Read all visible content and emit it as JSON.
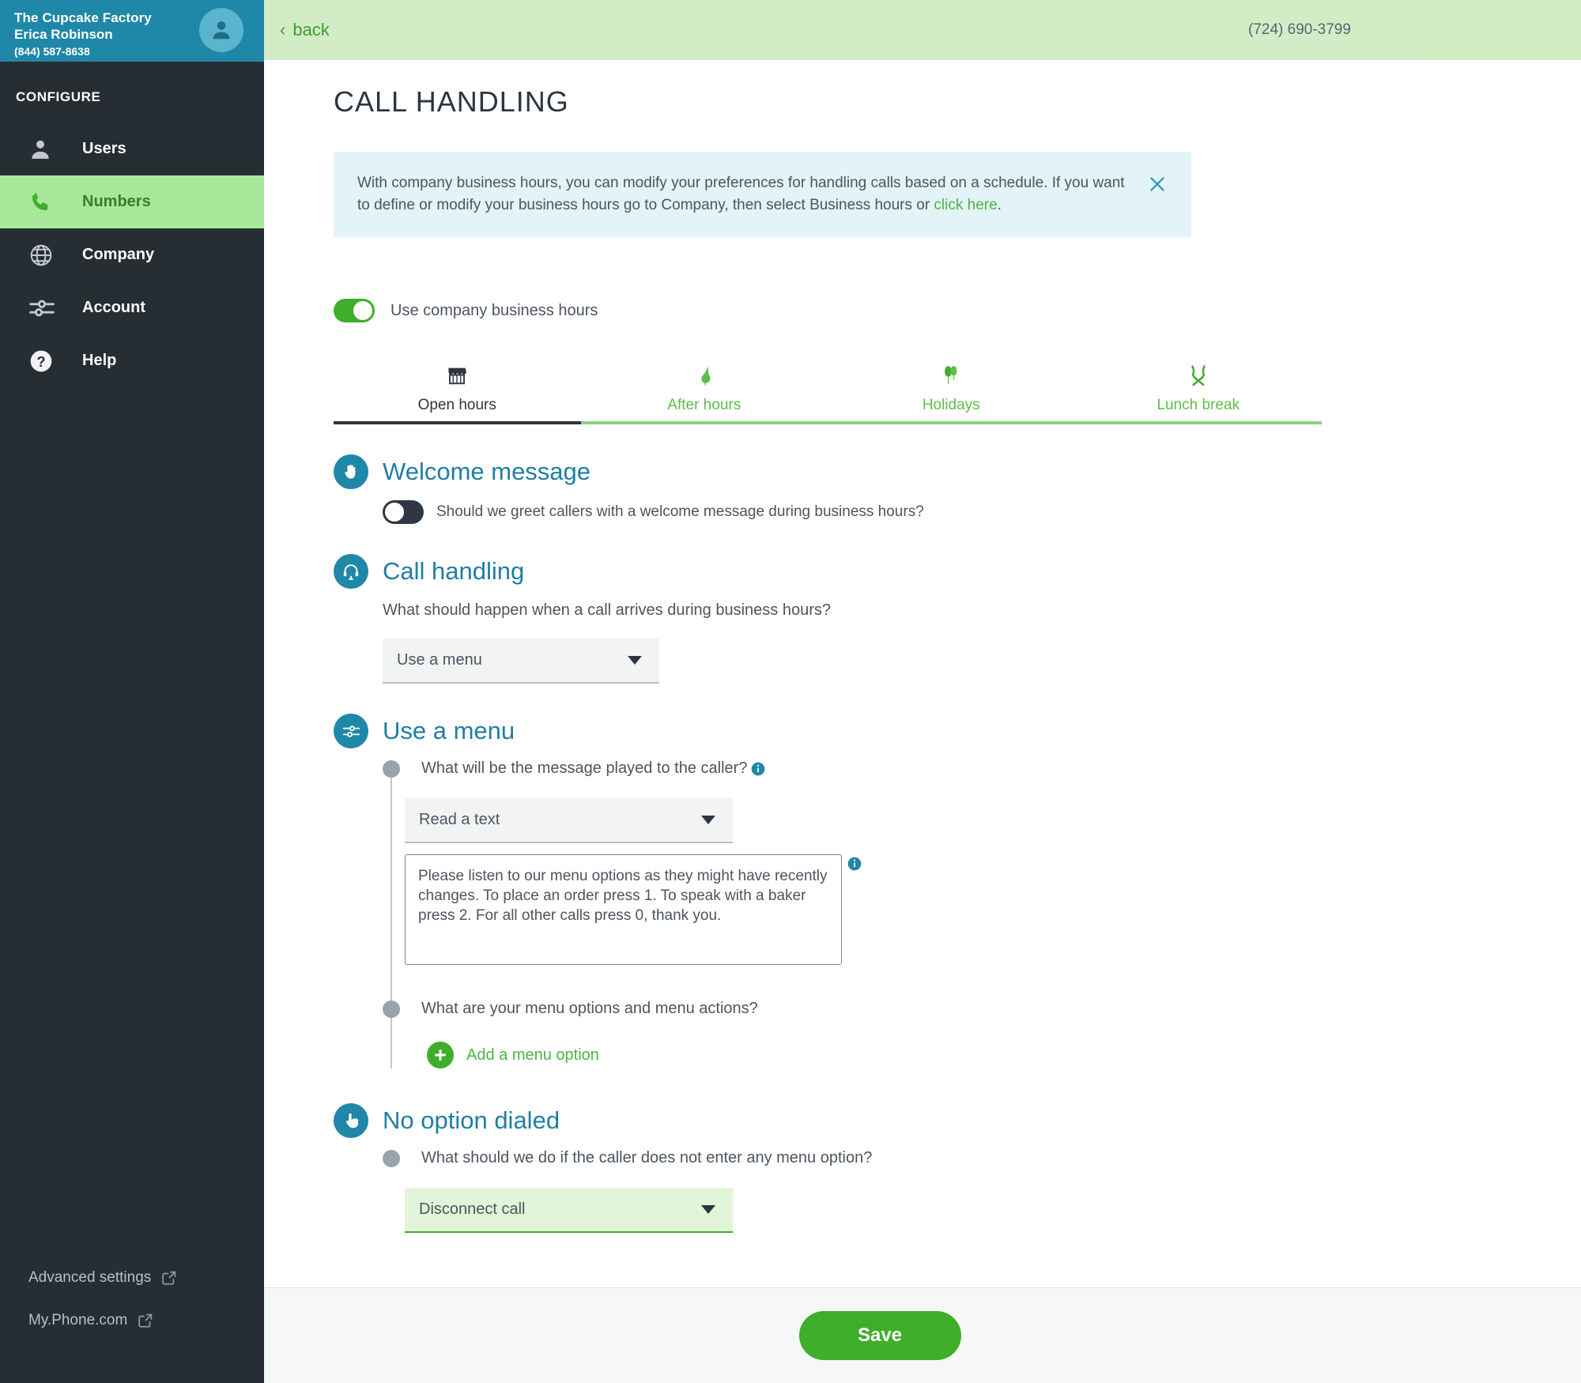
{
  "sidebar": {
    "company": "The Cupcake Factory",
    "user": "Erica Robinson",
    "phone": "(844) 587-8638",
    "avatar_icon": "user-avatar-icon",
    "section_label": "CONFIGURE",
    "items": [
      {
        "label": "Users",
        "icon": "user-icon",
        "active": false
      },
      {
        "label": "Numbers",
        "icon": "phone-icon",
        "active": true
      },
      {
        "label": "Company",
        "icon": "globe-icon",
        "active": false
      },
      {
        "label": "Account",
        "icon": "sliders-icon",
        "active": false
      },
      {
        "label": "Help",
        "icon": "question-circle-icon",
        "active": false
      }
    ],
    "bottom_links": [
      {
        "label": "Advanced settings",
        "icon": "external-link-icon"
      },
      {
        "label": "My.Phone.com",
        "icon": "external-link-icon"
      }
    ]
  },
  "topbar": {
    "back_label": "back",
    "back_icon": "chevron-left-icon",
    "phone": "(724) 690-3799"
  },
  "page": {
    "title": "CALL HANDLING"
  },
  "banner": {
    "text_part1": "With company business hours, you can modify your preferences for handling calls based on a schedule. If you want to define or modify your business hours go to Company, then select Business hours or ",
    "link_text": "click here",
    "text_part2": ".",
    "close_icon": "close-icon"
  },
  "business_hours_toggle": {
    "label": "Use company business hours",
    "state": "on"
  },
  "tabs": [
    {
      "label": "Open hours",
      "icon": "storefront-icon",
      "active": true
    },
    {
      "label": "After hours",
      "icon": "moon-icon",
      "active": false
    },
    {
      "label": "Holidays",
      "icon": "balloons-icon",
      "active": false
    },
    {
      "label": "Lunch break",
      "icon": "fork-knife-icon",
      "active": false
    }
  ],
  "welcome_message": {
    "title": "Welcome message",
    "icon": "hand-wave-icon",
    "toggle_state": "off",
    "toggle_label": "Should we greet callers with a welcome message during business hours?"
  },
  "call_handling": {
    "title": "Call handling",
    "icon": "headset-icon",
    "question": "What should happen when a call arrives during business hours?",
    "select_value": "Use a menu",
    "caret_icon": "chevron-down-icon"
  },
  "use_a_menu": {
    "title": "Use a menu",
    "icon": "sliders-icon",
    "question1": "What will be the message played to the caller?",
    "question1_info_icon": "info-icon",
    "message_source_value": "Read a text",
    "message_text": "Please listen to our menu options as they might have recently changes. To place an order press 1. To speak with a baker press 2. For all other calls press 0, thank you.",
    "textarea_info_icon": "info-icon",
    "question2": "What are your menu options and menu actions?",
    "add_option_label": "Add a menu option",
    "add_option_icon": "plus-circle-icon"
  },
  "no_option_dialed": {
    "title": "No option dialed",
    "icon": "hand-press-icon",
    "question": "What should we do if the caller does not enter any menu option?",
    "select_value": "Disconnect call"
  },
  "footer": {
    "save_label": "Save"
  },
  "colors": {
    "brand_teal": "#1f87a8",
    "brand_green": "#3fae2a",
    "sidebar_dark": "#262d33",
    "active_nav": "#a8e79a",
    "topbar_green": "#d2edc6",
    "banner_blue": "#e3f3f7"
  }
}
